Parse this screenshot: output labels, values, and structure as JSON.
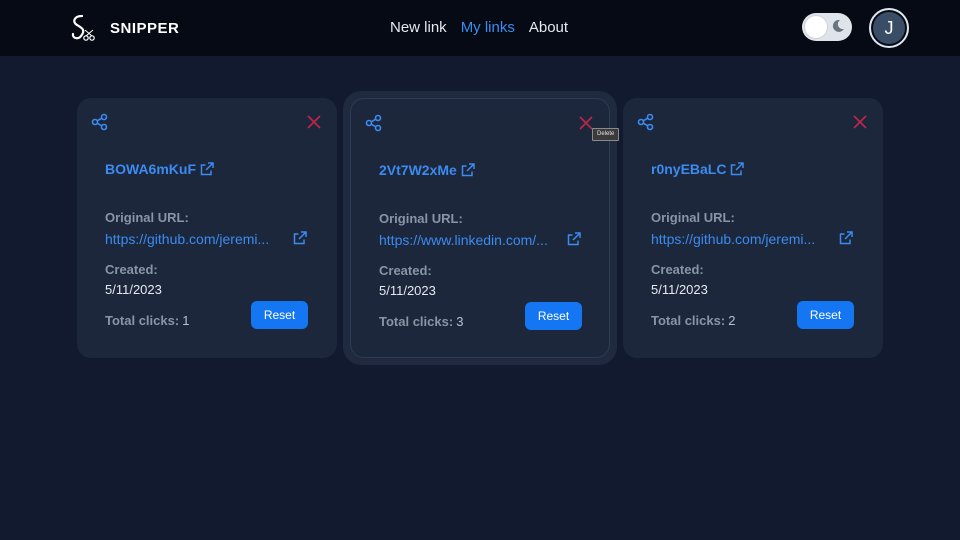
{
  "brand": {
    "name": "SNIPPER"
  },
  "nav": [
    {
      "label": "New link",
      "active": false
    },
    {
      "label": "My links",
      "active": true
    },
    {
      "label": "About",
      "active": false
    }
  ],
  "theme_toggle": {
    "mode": "light",
    "icon": "moon-icon"
  },
  "user": {
    "initial": "J"
  },
  "colors": {
    "accent": "#3b8bf0",
    "button": "#1476f2",
    "delete": "#c0264a",
    "background": "#111a2e",
    "card": "#1c273b"
  },
  "labels": {
    "original_url": "Original URL:",
    "created": "Created:",
    "total_clicks": "Total clicks:",
    "reset": "Reset"
  },
  "links": [
    {
      "short": "BOWA6mKuF",
      "original": "https://github.com/jeremi...",
      "created": "5/11/2023",
      "clicks": "1"
    },
    {
      "short": "2Vt7W2xMe",
      "original": "https://www.linkedin.com/...",
      "created": "5/11/2023",
      "clicks": "3"
    },
    {
      "short": "r0nyEBaLC",
      "original": "https://github.com/jeremi...",
      "created": "5/11/2023",
      "clicks": "2"
    }
  ],
  "tooltip": {
    "text": "Delete"
  }
}
